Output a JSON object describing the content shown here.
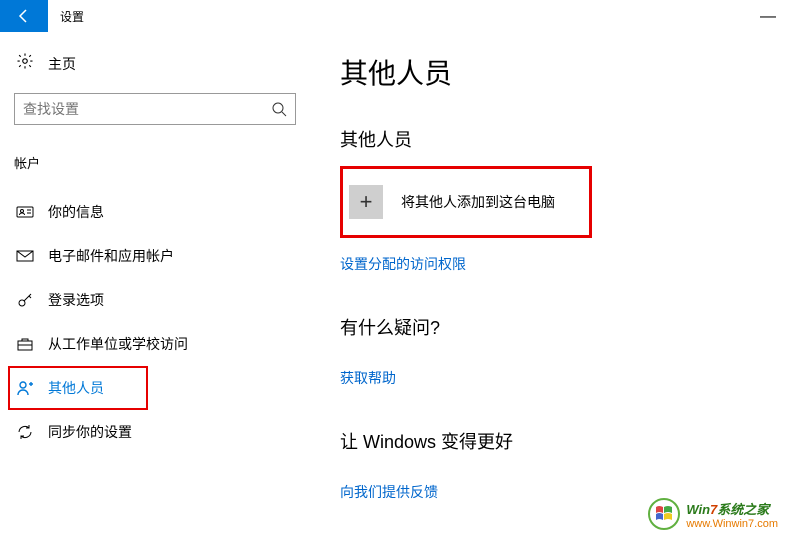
{
  "titlebar": {
    "title": "设置"
  },
  "sidebar": {
    "home": "主页",
    "search_placeholder": "查找设置",
    "section": "帐户",
    "items": [
      {
        "label": "你的信息"
      },
      {
        "label": "电子邮件和应用帐户"
      },
      {
        "label": "登录选项"
      },
      {
        "label": "从工作单位或学校访问"
      },
      {
        "label": "其他人员"
      },
      {
        "label": "同步你的设置"
      }
    ]
  },
  "main": {
    "title": "其他人员",
    "other_head": "其他人员",
    "add_label": "将其他人添加到这台电脑",
    "assigned_link": "设置分配的访问权限",
    "q_head": "有什么疑问?",
    "help_link": "获取帮助",
    "better_head": "让 Windows 变得更好",
    "feedback_link": "向我们提供反馈"
  },
  "watermark": {
    "brand_pre": "Win",
    "brand_num": "7",
    "brand_post": "系统之家",
    "url": "www.Winwin7.com"
  }
}
